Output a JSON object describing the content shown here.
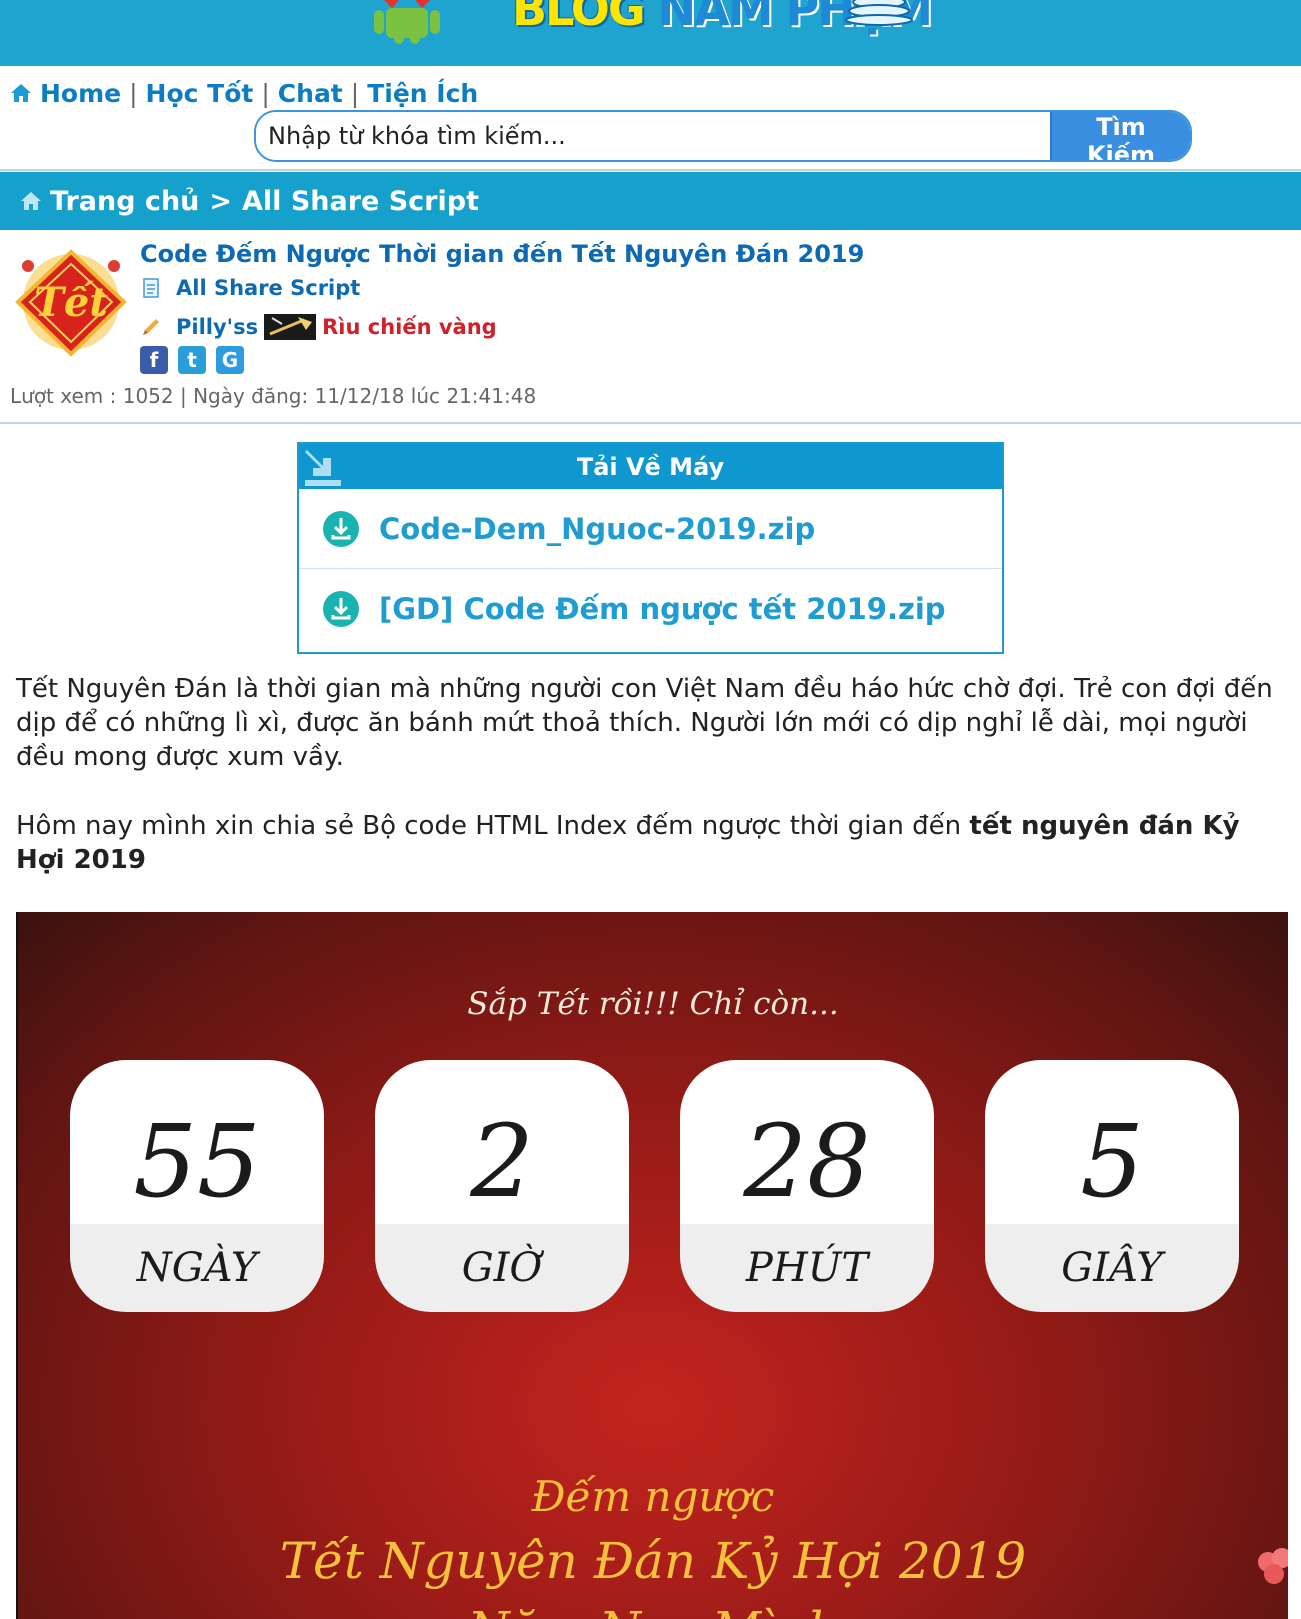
{
  "header": {
    "logo_text_1": "BLOG ",
    "logo_text_2": "NAM PHẠM"
  },
  "nav": {
    "items": [
      "Home",
      "Học Tốt",
      "Chat",
      "Tiện Ích"
    ],
    "separator": "|"
  },
  "search": {
    "placeholder": "Nhập từ khóa tìm kiếm...",
    "button_label": "Tìm Kiếm"
  },
  "breadcrumb": {
    "home": "Trang chủ",
    "arrow": ">",
    "current": "All Share Script"
  },
  "post": {
    "title": "Code Đếm Ngược Thời gian đến Tết Nguyên Đán 2019",
    "category": "All Share Script",
    "author": "Pilly'ss",
    "rank": "Rìu chiến vàng",
    "stats": "Lượt xem : 1052 | Ngày đăng: 11/12/18 lúc 21:41:48",
    "social": [
      "f",
      "t",
      "G"
    ]
  },
  "download": {
    "title": "Tải Về Máy",
    "files": [
      "Code-Dem_Nguoc-2019.zip",
      "[GD] Code Đếm ngược tết 2019.zip"
    ]
  },
  "article": {
    "para1": "Tết Nguyên Đán là thời gian mà những người con Việt Nam đều háo hức chờ đợi. Trẻ con đợi đến dịp để có những lì xì, được ăn bánh mứt thoả thích. Người lớn mới có dịp nghỉ lễ dài, mọi người đều mong được xum vầy.",
    "para2_plain": "Hôm nay mình xin chia sẻ Bộ code HTML Index đếm ngược thời gian đến ",
    "para2_bold": "tết nguyên đán Kỷ Hợi 2019"
  },
  "countdown": {
    "subtitle": "Sắp Tết rồi!!! Chỉ còn...",
    "units": [
      {
        "value": "55",
        "label": "NGÀY"
      },
      {
        "value": "2",
        "label": "GIỜ"
      },
      {
        "value": "28",
        "label": "PHÚT"
      },
      {
        "value": "5",
        "label": "GIÂY"
      }
    ],
    "line1": "Đếm ngược",
    "line2": "Tết Nguyên Đán Kỷ Hợi 2019",
    "line3": "Năm Nay Mình"
  },
  "colors": {
    "brand_blue": "#16a0cc",
    "link_blue": "#0c69b4",
    "rank_red": "#d0202a",
    "countdown_gold": "#f5c13a"
  }
}
